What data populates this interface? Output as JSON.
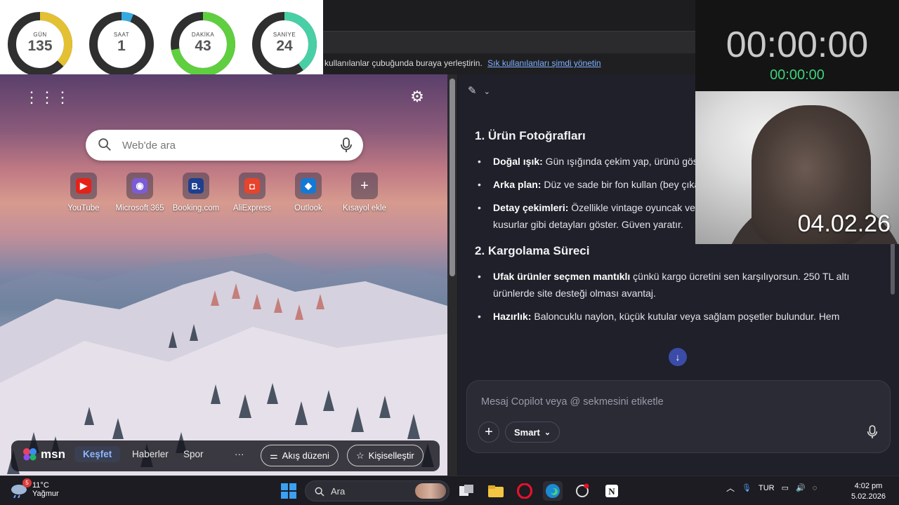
{
  "countdown": {
    "gauges": [
      {
        "label": "GÜN",
        "value": "135",
        "fraction": 0.37,
        "color": "#e3c132"
      },
      {
        "label": "SAAT",
        "value": "1",
        "fraction": 0.06,
        "color": "#38a9e0"
      },
      {
        "label": "DAKİKA",
        "value": "43",
        "fraction": 0.72,
        "color": "#5fcf3f"
      },
      {
        "label": "SANİYE",
        "value": "24",
        "fraction": 0.4,
        "color": "#49cfa5"
      }
    ]
  },
  "favbar": {
    "message": "kullanılanlar çubuğunda buraya yerleştirin.",
    "link": "Sık kullanılanları şimdi yönetin"
  },
  "newtab": {
    "search_placeholder": "Web'de ara",
    "tiles": [
      {
        "label": "YouTube",
        "color": "#e62117",
        "glyph": "▶"
      },
      {
        "label": "Microsoft 365",
        "color": "#7b5cd6",
        "glyph": "◉"
      },
      {
        "label": "Booking.com",
        "color": "#1e3f8f",
        "glyph": "B."
      },
      {
        "label": "AliExpress",
        "color": "#e8432b",
        "glyph": "◘"
      },
      {
        "label": "Outlook",
        "color": "#1479d4",
        "glyph": "◆"
      },
      {
        "label": "Kısayol ekle",
        "color": "transparent",
        "glyph": "+"
      }
    ],
    "msn": {
      "logo": "msn",
      "nav": [
        "Keşfet",
        "Haberler",
        "Spor",
        "···"
      ],
      "layout_button": "Akış düzeni",
      "personalize_button": "Kişiselleştir"
    }
  },
  "copilot": {
    "section1_title": "1. Ürün Fotoğrafları",
    "section1_items": [
      {
        "bold": "Doğal ışık:",
        "text": " Gün ışığında çekim yap, ürünü gösterir."
      },
      {
        "bold": "Arka plan:",
        "text": " Düz ve sade bir fon kullan (bey çıkarır."
      },
      {
        "bold": "Detay çekimleri:",
        "text": " Özellikle vintage oyuncak veya kıyafetlerde dikiş, etiket, küçük kusurlar gibi detayları göster. Güven yaratır."
      }
    ],
    "section2_title": "2. Kargolama Süreci",
    "section2_items": [
      {
        "bold": "Ufak ürünler seçmen mantıklı",
        "text": " çünkü kargo ücretini sen karşılıyorsun. 250 TL altı ürünlerde site desteği olması avantaj."
      },
      {
        "bold": "Hazırlık:",
        "text": " Baloncuklu naylon, küçük kutular veya sağlam poşetler bulundur. Hem"
      }
    ],
    "input_placeholder": "Mesaj Copilot veya @ sekmesini etiketle",
    "mode_button": "Smart"
  },
  "timer": {
    "main": "00:00:00",
    "sub": "00:00:00"
  },
  "webcam": {
    "date_overlay": "04.02.26"
  },
  "taskbar": {
    "weather_temp": "11°C",
    "weather_desc": "Yağmur",
    "weather_badge": "5",
    "search_label": "Ara",
    "language": "TUR",
    "time": "4:02 pm",
    "date": "5.02.2026"
  }
}
